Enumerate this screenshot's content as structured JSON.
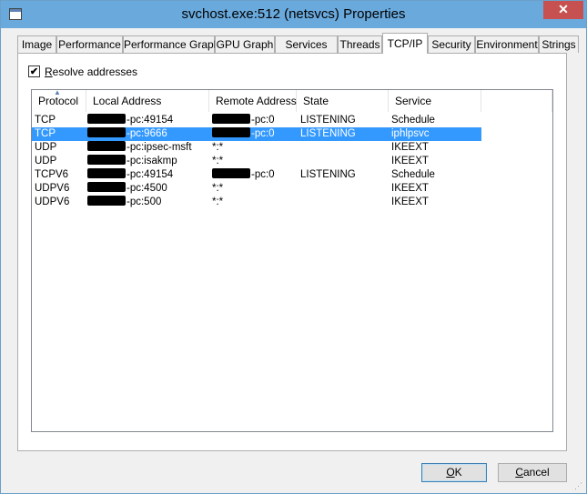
{
  "window": {
    "title": "svchost.exe:512 (netsvcs) Properties",
    "close_glyph": "✕"
  },
  "tabs": [
    {
      "label": "Image"
    },
    {
      "label": "Performance"
    },
    {
      "label": "Performance Graph"
    },
    {
      "label": "GPU Graph"
    },
    {
      "label": "Services"
    },
    {
      "label": "Threads"
    },
    {
      "label": "TCP/IP"
    },
    {
      "label": "Security"
    },
    {
      "label": "Environment"
    },
    {
      "label": "Strings"
    }
  ],
  "active_tab": "TCP/IP",
  "resolve": {
    "label": "Resolve addresses",
    "checked_glyph": "✔"
  },
  "columns": [
    "Protocol",
    "Local Address",
    "Remote Address",
    "State",
    "Service"
  ],
  "sort_indicator": "▲",
  "rows": [
    {
      "protocol": "TCP",
      "local": "-pc:49154",
      "remote": "-pc:0",
      "state": "LISTENING",
      "service": "Schedule",
      "local_redacted": true,
      "remote_redacted": true,
      "selected": false
    },
    {
      "protocol": "TCP",
      "local": "-pc:9666",
      "remote": "-pc:0",
      "state": "LISTENING",
      "service": "iphlpsvc",
      "local_redacted": true,
      "remote_redacted": true,
      "selected": true
    },
    {
      "protocol": "UDP",
      "local": "-pc:ipsec-msft",
      "remote": "*:*",
      "state": "",
      "service": "IKEEXT",
      "local_redacted": true,
      "remote_redacted": false,
      "selected": false
    },
    {
      "protocol": "UDP",
      "local": "-pc:isakmp",
      "remote": "*:*",
      "state": "",
      "service": "IKEEXT",
      "local_redacted": true,
      "remote_redacted": false,
      "selected": false
    },
    {
      "protocol": "TCPV6",
      "local": "-pc:49154",
      "remote": "-pc:0",
      "state": "LISTENING",
      "service": "Schedule",
      "local_redacted": true,
      "remote_redacted": true,
      "selected": false
    },
    {
      "protocol": "UDPV6",
      "local": "-pc:4500",
      "remote": "*:*",
      "state": "",
      "service": "IKEEXT",
      "local_redacted": true,
      "remote_redacted": false,
      "selected": false
    },
    {
      "protocol": "UDPV6",
      "local": "-pc:500",
      "remote": "*:*",
      "state": "",
      "service": "IKEEXT",
      "local_redacted": true,
      "remote_redacted": false,
      "selected": false
    }
  ],
  "buttons": {
    "ok": "OK",
    "cancel": "Cancel"
  },
  "colors": {
    "titlebar": "#69a9dc",
    "close": "#c75050",
    "selection": "#3399ff"
  }
}
